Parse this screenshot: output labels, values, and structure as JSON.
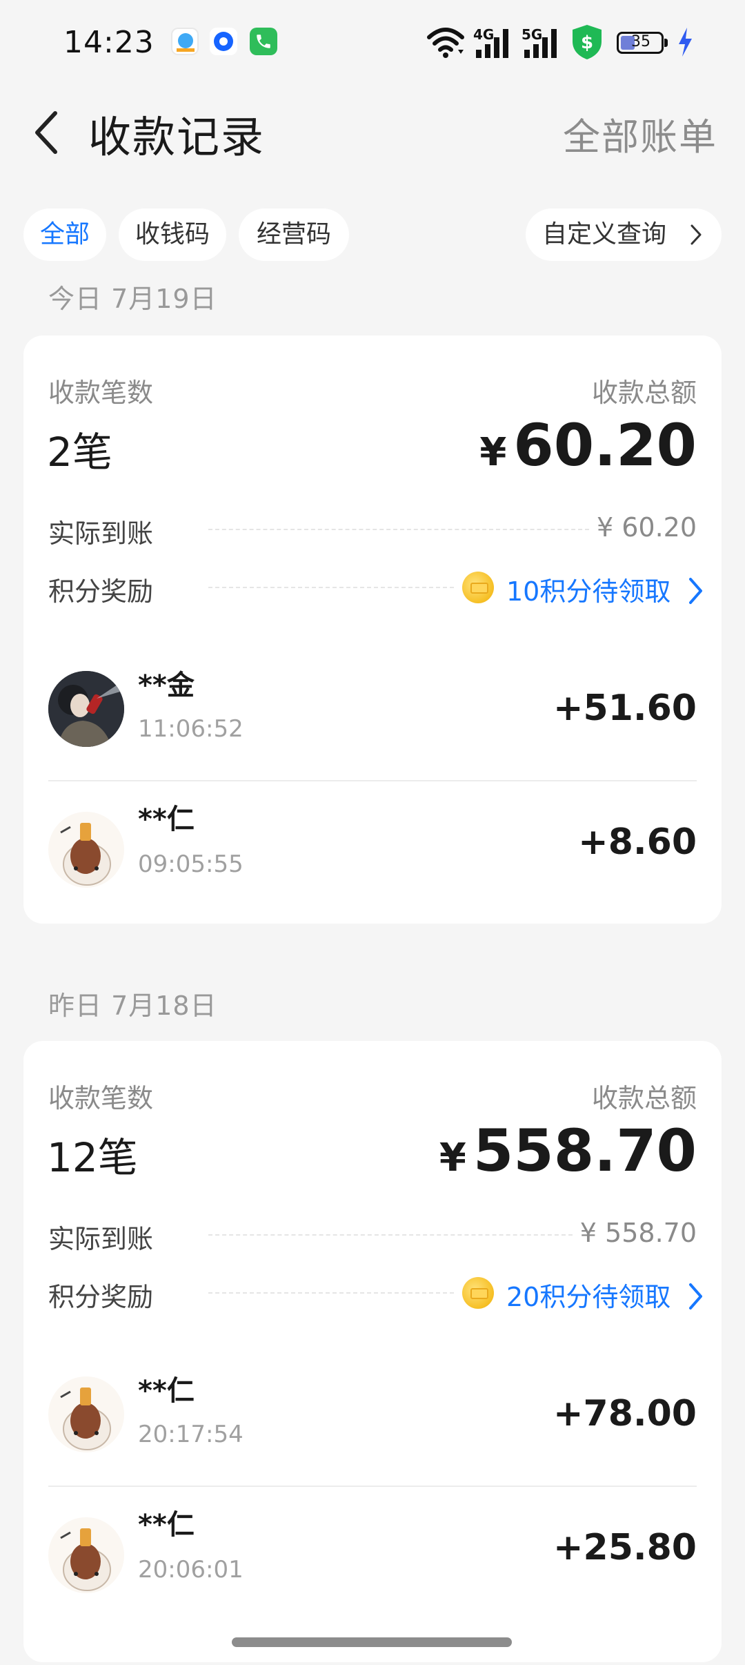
{
  "status_bar": {
    "time": "14:23",
    "network_1": "4G",
    "network_2": "5G",
    "battery": "35",
    "icons": [
      "app-notification-icon",
      "chat-notification-icon",
      "phone-notification-icon",
      "wifi-icon",
      "signal-4g-icon",
      "signal-5g-icon",
      "security-shield-icon",
      "battery-icon",
      "charging-icon"
    ]
  },
  "nav": {
    "title": "收款记录",
    "right_action": "全部账单"
  },
  "filters": {
    "chips": [
      "全部",
      "收钱码",
      "经营码"
    ],
    "active": "全部",
    "custom_query": "自定义查询"
  },
  "days": [
    {
      "label": "今日 7月19日",
      "count_label": "收款笔数",
      "count": "2笔",
      "total_label": "收款总额",
      "currency": "¥",
      "total": "60.20",
      "actual_label": "实际到账",
      "actual_value": "¥ 60.20",
      "reward_label": "积分奖励",
      "reward_value": "10积分待领取",
      "transactions": [
        {
          "name": "**金",
          "time": "11:06:52",
          "amount": "+51.60"
        },
        {
          "name": "**仁",
          "time": "09:05:55",
          "amount": "+8.60"
        }
      ]
    },
    {
      "label": "昨日 7月18日",
      "count_label": "收款笔数",
      "count": "12笔",
      "total_label": "收款总额",
      "currency": "¥",
      "total": "558.70",
      "actual_label": "实际到账",
      "actual_value": "¥ 558.70",
      "reward_label": "积分奖励",
      "reward_value": "20积分待领取",
      "transactions": [
        {
          "name": "**仁",
          "time": "20:17:54",
          "amount": "+78.00"
        },
        {
          "name": "**仁",
          "time": "20:06:01",
          "amount": "+25.80"
        }
      ]
    }
  ],
  "colors": {
    "accent": "#1677ff",
    "background": "#f5f5f5",
    "card": "#ffffff",
    "muted": "#8a8a8a"
  }
}
